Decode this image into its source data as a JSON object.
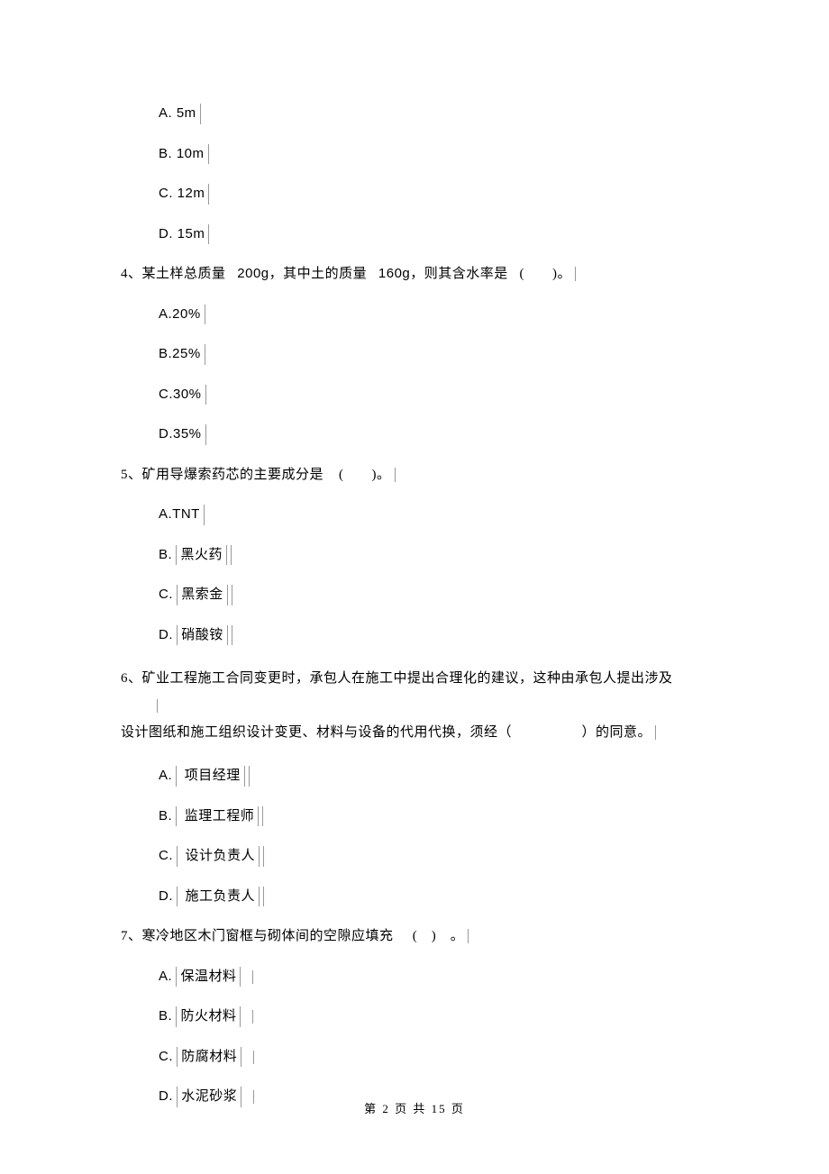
{
  "options_q3": {
    "a": "A. 5m",
    "b": "B. 10m",
    "c": "C. 12m",
    "d": "D. 15m"
  },
  "q4": {
    "stem_prefix": "4、某土样总质量",
    "stem_mid1": "200g，其中土的质量",
    "stem_mid2": "160g，则其含水率是",
    "stem_suffix": "(　　)。",
    "a": "A.20%",
    "b": "B.25%",
    "c": "C.30%",
    "d": "D.35%"
  },
  "q5": {
    "stem_prefix": "5、矿用导爆索药芯的主要成分是",
    "stem_suffix": "(　　)。",
    "a": "A.TNT",
    "b_label": "B.",
    "b_text": "黑火药",
    "c_label": "C.",
    "c_text": "黑索金",
    "d_label": "D.",
    "d_text": "硝酸铵"
  },
  "q6": {
    "line1": "6、矿业工程施工合同变更时，承包人在施工中提出合理化的建议，这种由承包人提出涉及",
    "line2_prefix": "设计图纸和施工组织设计变更、材料与设备的代用代换，须经（　　　　　）的同意。",
    "a_label": "A.",
    "a_text": "项目经理",
    "b_label": "B.",
    "b_text": "监理工程师",
    "c_label": "C.",
    "c_text": "设计负责人",
    "d_label": "D.",
    "d_text": "施工负责人"
  },
  "q7": {
    "stem_prefix": "7、寒冷地区木门窗框与砌体间的空隙应填充",
    "stem_suffix": "(　)　。",
    "a_label": "A.",
    "a_text": "保温材料",
    "b_label": "B.",
    "b_text": "防火材料",
    "c_label": "C.",
    "c_text": "防腐材料",
    "d_label": "D.",
    "d_text": "水泥砂浆"
  },
  "footer": "第  2 页  共  15  页"
}
